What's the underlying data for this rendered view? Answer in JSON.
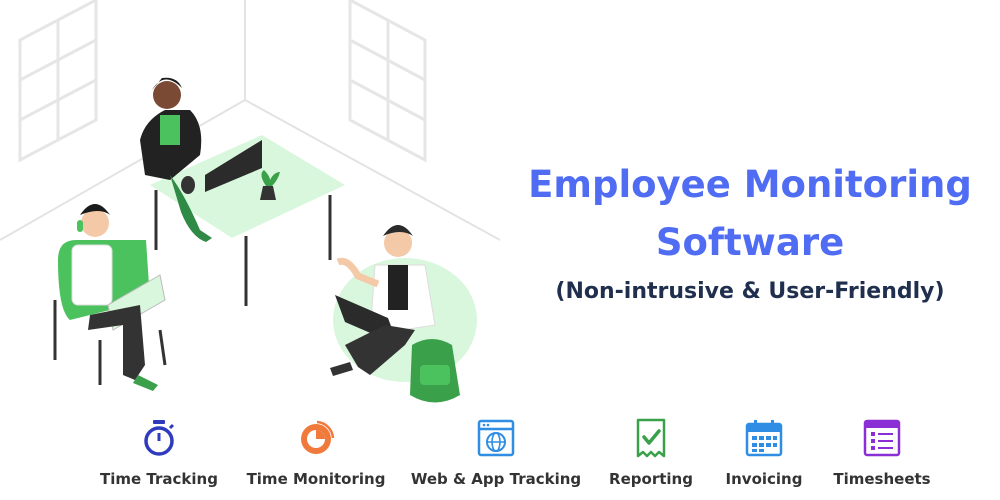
{
  "headline": {
    "line1": "Employee Monitoring",
    "line2": "Software",
    "subtitle": "(Non-intrusive & User-Friendly)"
  },
  "colors": {
    "headline": "#4f6cf2",
    "subtitle": "#1f2f4d",
    "accent_green": "#4cc25e"
  },
  "features": [
    {
      "label": "Time Tracking",
      "icon": "stopwatch-icon",
      "color": "#2e3bbd"
    },
    {
      "label": "Time Monitoring",
      "icon": "pie-chart-icon",
      "color": "#f07a3c"
    },
    {
      "label": "Web & App Tracking",
      "icon": "browser-globe-icon",
      "color": "#2f8de4"
    },
    {
      "label": "Reporting",
      "icon": "report-check-icon",
      "color": "#3aa14a"
    },
    {
      "label": "Invoicing",
      "icon": "calendar-icon",
      "color": "#2f8de4"
    },
    {
      "label": "Timesheets",
      "icon": "timesheet-list-icon",
      "color": "#8a2fd6"
    }
  ]
}
